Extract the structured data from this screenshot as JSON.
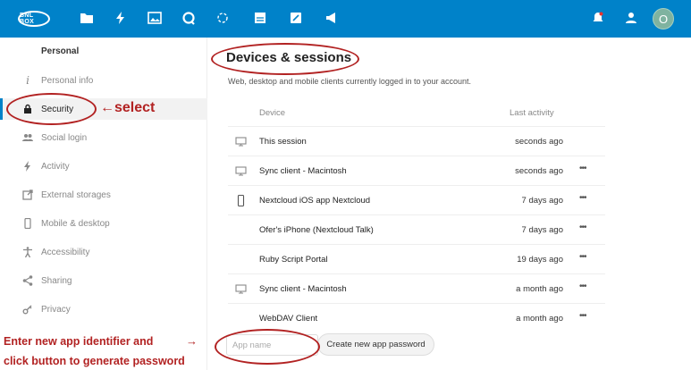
{
  "topbar": {
    "logo_text": "BNL BOX",
    "apps": [
      {
        "icon": "folder-icon"
      },
      {
        "icon": "activity-icon"
      },
      {
        "icon": "photos-icon"
      },
      {
        "icon": "talk-icon"
      },
      {
        "icon": "circles-icon"
      },
      {
        "icon": "notes-icon"
      },
      {
        "icon": "edit-icon"
      },
      {
        "icon": "announcement-icon"
      }
    ],
    "avatar_letter": "O",
    "colors": {
      "bar": "#0082c9",
      "avatar": "#7fb3a0"
    }
  },
  "sidebar": {
    "heading": "Personal",
    "items": [
      {
        "label": "Personal info",
        "icon": "info-icon"
      },
      {
        "label": "Security",
        "icon": "lock-icon",
        "active": true
      },
      {
        "label": "Social login",
        "icon": "users-icon"
      },
      {
        "label": "Activity",
        "icon": "activity-icon"
      },
      {
        "label": "External storages",
        "icon": "external-icon"
      },
      {
        "label": "Mobile & desktop",
        "icon": "phone-icon"
      },
      {
        "label": "Accessibility",
        "icon": "accessibility-icon"
      },
      {
        "label": "Sharing",
        "icon": "share-icon"
      },
      {
        "label": "Privacy",
        "icon": "key-icon"
      }
    ]
  },
  "main": {
    "title": "Devices & sessions",
    "description": "Web, desktop and mobile clients currently logged in to your account.",
    "columns": {
      "device": "Device",
      "last_activity": "Last activity"
    },
    "sessions": [
      {
        "name": "This session",
        "activity": "seconds ago",
        "icon": "desktop-icon",
        "more": false
      },
      {
        "name": "Sync client - Macintosh",
        "activity": "seconds ago",
        "icon": "desktop-icon",
        "more": true
      },
      {
        "name": "Nextcloud iOS app Nextcloud",
        "activity": "7 days ago",
        "icon": "phone-icon",
        "more": true
      },
      {
        "name": "Ofer's iPhone (Nextcloud Talk)",
        "activity": "7 days ago",
        "icon": "",
        "more": true
      },
      {
        "name": "Ruby Script Portal",
        "activity": "19 days ago",
        "icon": "",
        "more": true
      },
      {
        "name": "Sync client - Macintosh",
        "activity": "a month ago",
        "icon": "desktop-icon",
        "more": true
      },
      {
        "name": "WebDAV Client",
        "activity": "a month ago",
        "icon": "",
        "more": true
      }
    ],
    "more_label": "•••",
    "app_name_placeholder": "App name",
    "create_button": "Create new app password"
  },
  "annotations": {
    "select": "←select",
    "enter_line1": "Enter new app identifier and",
    "enter_arrow": "→",
    "enter_line2": "click button to generate password",
    "color": "#b22222"
  }
}
